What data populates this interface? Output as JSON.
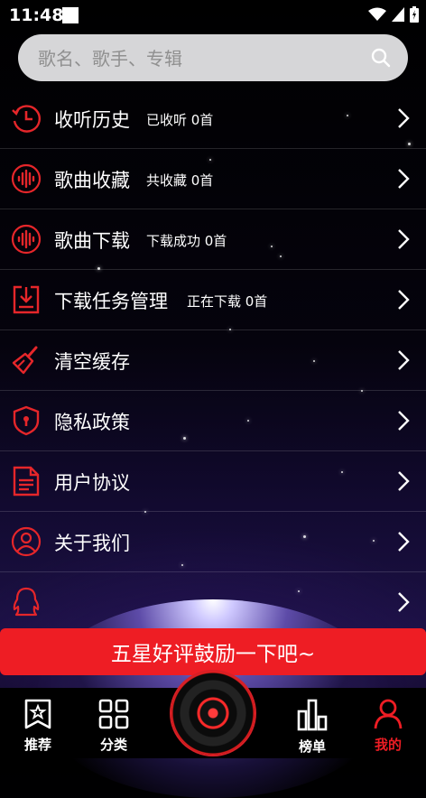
{
  "status": {
    "time": "11:48"
  },
  "search": {
    "placeholder": "歌名、歌手、专辑"
  },
  "menu": [
    {
      "icon": "history-clock-icon",
      "title": "收听历史",
      "sub": "已收听 0首"
    },
    {
      "icon": "sound-wave-icon",
      "title": "歌曲收藏",
      "sub": "共收藏 0首"
    },
    {
      "icon": "sound-wave-icon",
      "title": "歌曲下载",
      "sub": "下载成功 0首"
    },
    {
      "icon": "download-tray-icon",
      "title": "下载任务管理",
      "sub": "正在下载 0首"
    },
    {
      "icon": "broom-icon",
      "title": "清空缓存",
      "sub": ""
    },
    {
      "icon": "shield-lock-icon",
      "title": "隐私政策",
      "sub": ""
    },
    {
      "icon": "document-icon",
      "title": "用户协议",
      "sub": ""
    },
    {
      "icon": "user-circle-icon",
      "title": "关于我们",
      "sub": ""
    },
    {
      "icon": "qq-penguin-icon",
      "title": "",
      "sub": ""
    }
  ],
  "banner": {
    "text": "五星好评鼓励一下吧~"
  },
  "tabs": [
    {
      "label": "推荐",
      "icon": "star-book-icon",
      "active": false
    },
    {
      "label": "分类",
      "icon": "grid-icon",
      "active": false
    },
    {
      "label": "榜单",
      "icon": "chart-bars-icon",
      "active": false
    },
    {
      "label": "我的",
      "icon": "person-icon",
      "active": true
    }
  ],
  "colors": {
    "accent": "#ee1d24",
    "icon_red": "#e5262a"
  }
}
